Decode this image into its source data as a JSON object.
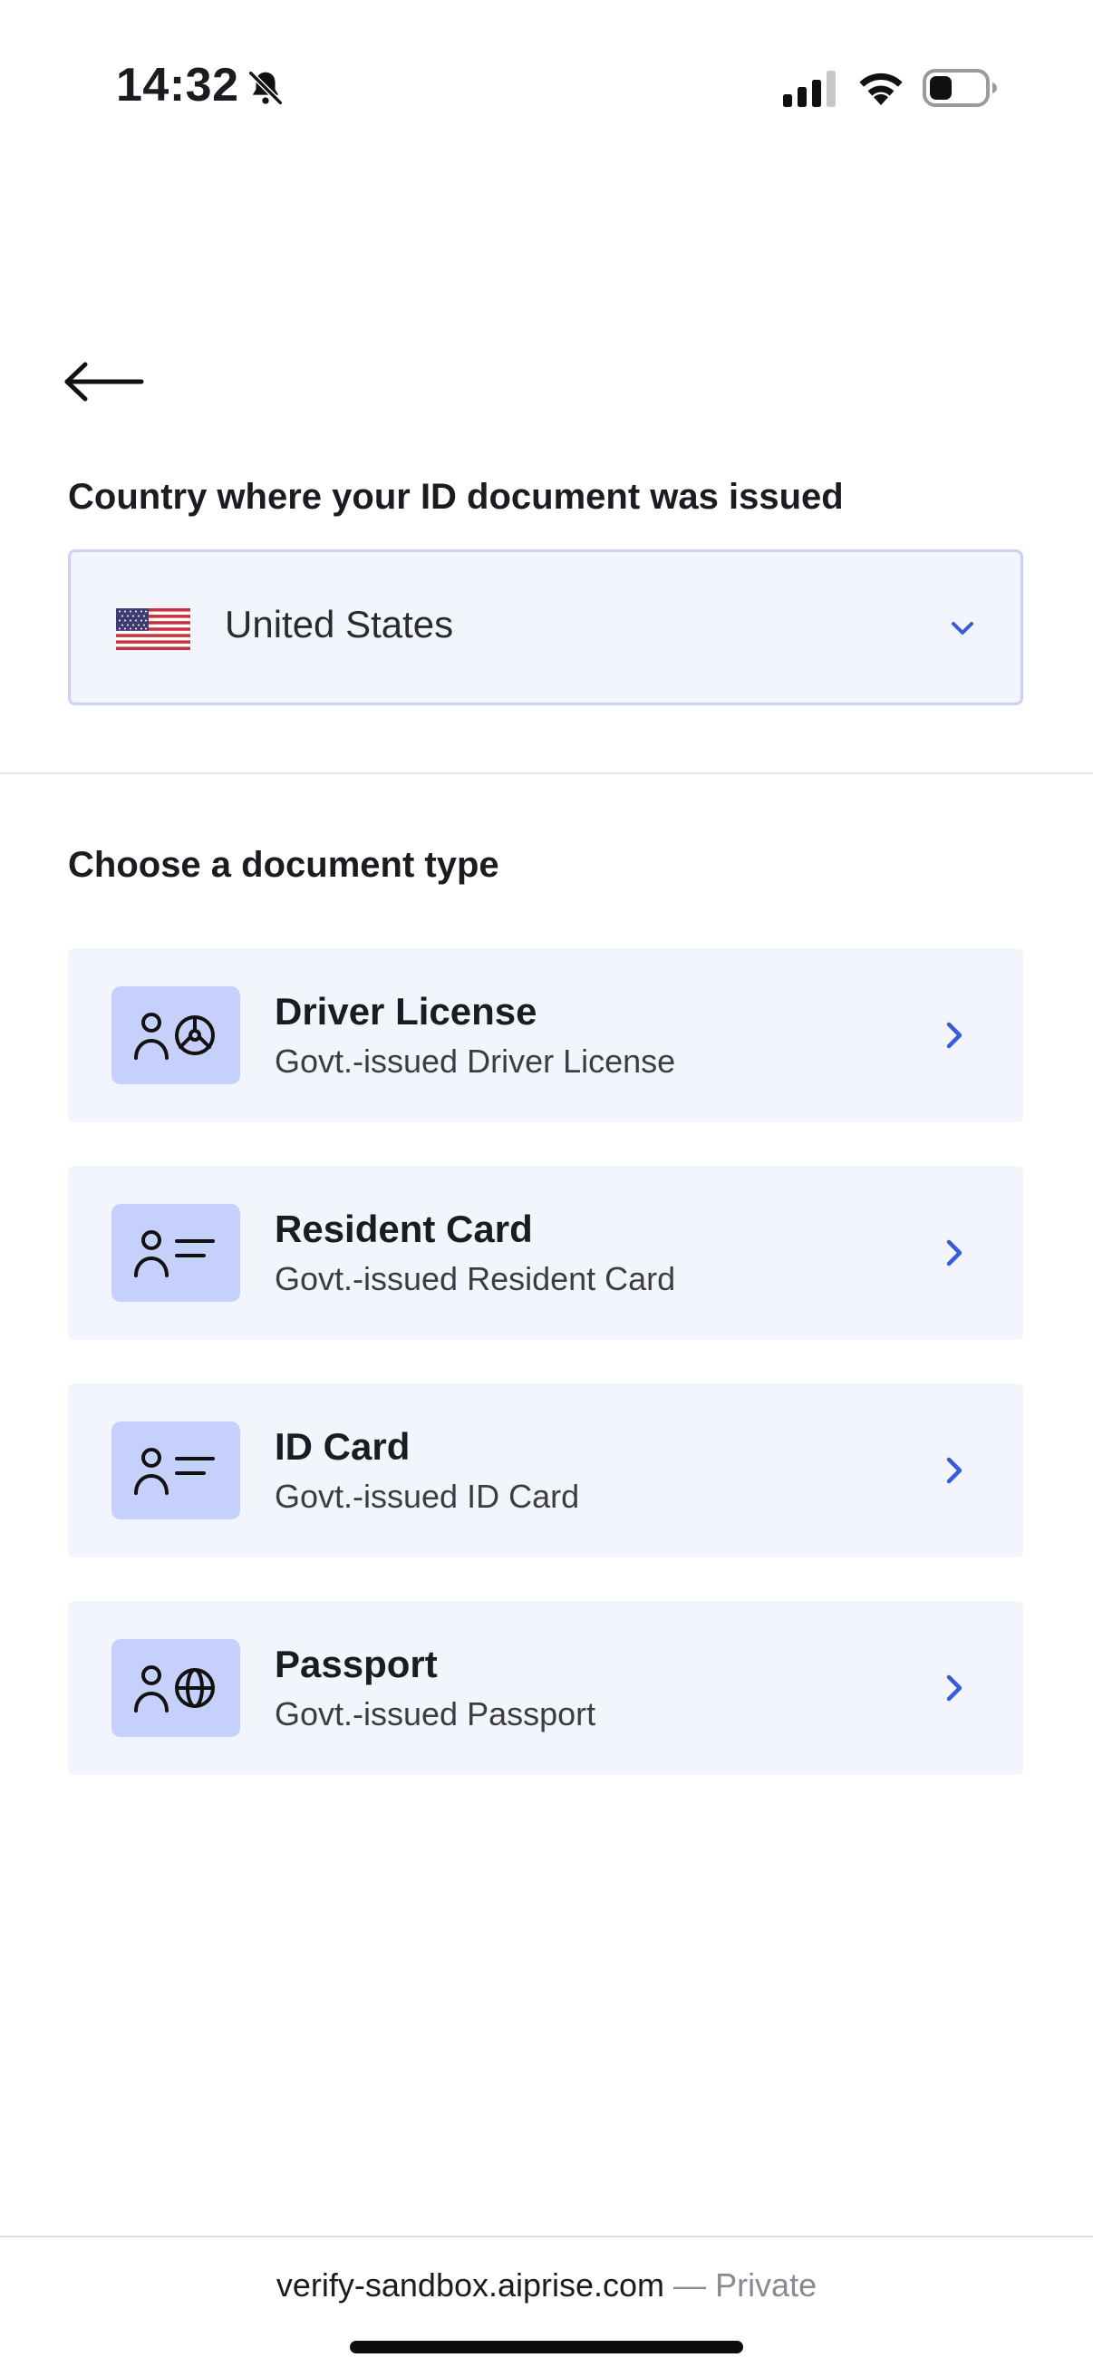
{
  "status_bar": {
    "time": "14:32",
    "icons": [
      "bell-slash-icon",
      "signal-icon",
      "wifi-icon",
      "battery-icon"
    ]
  },
  "back_icon": "arrow-left-icon",
  "country_section": {
    "label": "Country where your ID document was issued",
    "selected_country": "United States",
    "flag_icon": "us-flag-icon",
    "dropdown_icon": "chevron-down-icon"
  },
  "document_section": {
    "label": "Choose a document type",
    "items": [
      {
        "title": "Driver License",
        "subtitle": "Govt.-issued Driver License",
        "icon": "person-steering-wheel-icon"
      },
      {
        "title": "Resident Card",
        "subtitle": "Govt.-issued Resident Card",
        "icon": "person-card-icon"
      },
      {
        "title": "ID Card",
        "subtitle": "Govt.-issued ID Card",
        "icon": "person-card-icon"
      },
      {
        "title": "Passport",
        "subtitle": "Govt.-issued Passport",
        "icon": "person-globe-icon"
      }
    ]
  },
  "browser_footer": {
    "domain": "verify-sandbox.aiprise.com",
    "separator": " — ",
    "mode": "Private"
  },
  "colors": {
    "accent": "#3a5bdc",
    "card_bg": "#f3f5fd",
    "icon_box_bg": "#c5d0fb",
    "select_border": "#c9d1f7"
  }
}
